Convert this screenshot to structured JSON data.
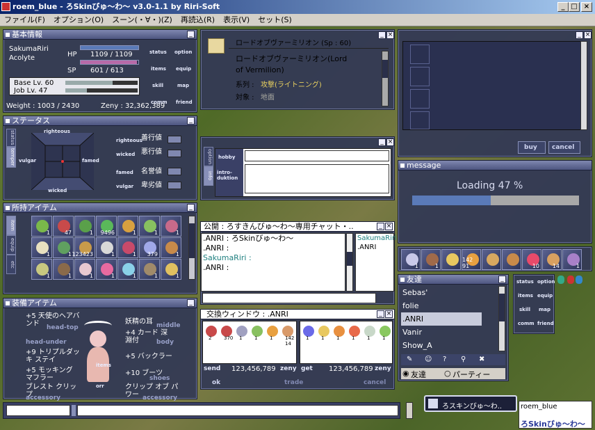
{
  "app": {
    "title": "roem_blue - ろSkinびゅ～わ～ v3.0-1.1 by Riri-Soft",
    "minimize": "_",
    "maximize": "□",
    "close": "×"
  },
  "menu": [
    "ファイル(F)",
    "オプション(O)",
    "スーン(・∀・)(Z)",
    "再読込(R)",
    "表示(V)",
    "セット(S)"
  ],
  "basic": {
    "title": "基本情報",
    "name": "SakumaRiri",
    "job": "Acolyte",
    "hp_label": "HP",
    "hp": "1109 / 1109",
    "hp_ratio": 1.0,
    "sp_label": "SP",
    "sp": "601 / 613",
    "sp_ratio": 0.98,
    "base_lv": "Base Lv. 60",
    "job_lv": "Job Lv. 47",
    "base_exp_ratio": 0.65,
    "job_exp_ratio": 0.3,
    "weight": "Weight : 1003 / 2430",
    "zeny": "Zeny : 32,362,389",
    "buttons": [
      "status",
      "option",
      "items",
      "equip",
      "skill",
      "map",
      "comm",
      "friend"
    ]
  },
  "status": {
    "title": "ステータス",
    "tabs": [
      "status",
      "temper"
    ],
    "labels": [
      "righteous",
      "wicked",
      "famed",
      "vulgar"
    ],
    "right_labels": [
      "righteous",
      "wicked",
      "famed",
      "vulgar"
    ],
    "jp_labels": [
      "善行値",
      "悪行値",
      "名誉値",
      "卑劣値"
    ]
  },
  "items": {
    "title": "所持アイテム",
    "tabs": [
      "item",
      "equip",
      "etc"
    ],
    "counts": [
      "1",
      "47",
      "1",
      "9496",
      "1",
      "1",
      "1",
      "1",
      "1",
      "123423",
      "1",
      "1",
      "379",
      "1",
      "1",
      "1",
      "1",
      "1",
      "1",
      "1",
      "1"
    ]
  },
  "equip": {
    "title": "装備アイテム",
    "left": [
      "+5 天使のヘアバンド",
      "head-under",
      "+9 トリプルダッキ ステイ",
      "+5 モッキング マフラー",
      "ブレスト クリップ"
    ],
    "left_ghost": [
      "head-top",
      "accessory"
    ],
    "right": [
      "妖精の耳",
      "+4 カード 深淵付",
      "+5 バックラー",
      "+10 ブーツ",
      "クリップ オブ パワー"
    ],
    "right_ghost": [
      "middle",
      "body",
      "shoes",
      "accessory"
    ],
    "center": [
      "items",
      "orr"
    ]
  },
  "skill": {
    "title": "ロードオブヴァーミリオン (Sp : 60)",
    "name": "ロードオブヴァーミリオン(Lord of Vermilion)",
    "attr_label": "系列 :",
    "attr_value": "攻撃(ライトニング)",
    "target_label": "対象 :",
    "target_value": "地面"
  },
  "profile": {
    "tabs": [
      "option",
      "info"
    ],
    "hobby_label": "hobby",
    "intro_label": "intro-duktion",
    "hobby_value": "",
    "intro_value": ""
  },
  "chat": {
    "title": "公開 : ろすきんびゅ～わ～専用チャット・..",
    "lines": [
      ".ANRI : ろSkinびゅ～わ～",
      ".ANRI :",
      "SakumaRiri :",
      ".ANRI :"
    ],
    "members": [
      "SakumaRiri",
      ".ANRI"
    ]
  },
  "trade": {
    "title": "交換ウィンドウ : .ANRI",
    "send_counts": [
      "2",
      "370",
      "1",
      "1",
      "1",
      "142 14"
    ],
    "get_counts": [
      "1",
      "1",
      "1",
      "1",
      "1",
      "1"
    ],
    "send": "send",
    "get": "get",
    "send_zeny": "123,456,789",
    "get_zeny": "123,456,789",
    "zeny": "zeny",
    "ok": "ok",
    "trade": "trade",
    "cancel": "cancel"
  },
  "shop": {
    "buy": "buy",
    "cancel": "cancel"
  },
  "message": {
    "title": "message",
    "text": "Loading 47 %",
    "progress": 0.47
  },
  "hotbar": {
    "counts": [
      "1",
      "1",
      "",
      "142 91",
      "",
      "",
      "10",
      "14",
      "1"
    ]
  },
  "friends": {
    "title": "友達",
    "list": [
      "Sebas'",
      "folie",
      ".ANRI",
      "Vanir",
      "Show_A"
    ],
    "selected": 2,
    "radio_friend": "友達",
    "radio_party": "パーティー"
  },
  "mini": {
    "buttons": [
      "status",
      "option",
      "items",
      "equip",
      "skill",
      "map",
      "comm",
      "friend"
    ]
  },
  "bottom": {
    "chat_name": "",
    "chat_input": "",
    "balloon": "ろスキンびゅ～わ..",
    "username": "roem_blue",
    "logo": "ろSkinびゅ～わ～"
  },
  "colors": {
    "window": "#343a54",
    "accent": "#8890b8",
    "hp": "#5a7ab8",
    "sp": "#b86aa8",
    "progress": "#5a7ab8"
  }
}
